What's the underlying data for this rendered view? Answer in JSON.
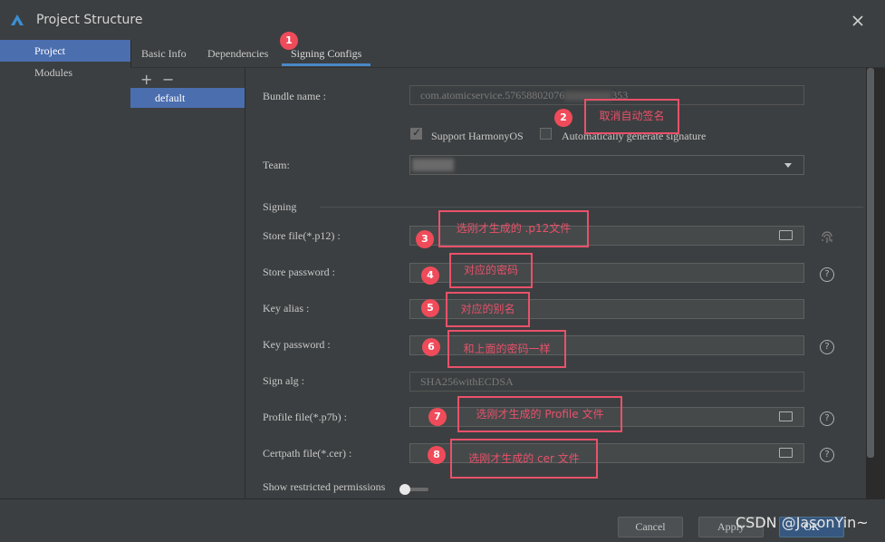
{
  "window": {
    "title": "Project Structure",
    "close_icon": "close-icon"
  },
  "left_nav": {
    "items": [
      {
        "label": "Project",
        "selected": true
      },
      {
        "label": "Modules",
        "selected": false
      }
    ]
  },
  "tabs": [
    {
      "label": "Basic Info"
    },
    {
      "label": "Dependencies"
    },
    {
      "label": "Signing Configs",
      "active": true
    }
  ],
  "config_list": {
    "add_label": "+",
    "remove_label": "−",
    "items": [
      {
        "label": "default"
      }
    ]
  },
  "form": {
    "bundle_name": {
      "label": "Bundle name :",
      "value": "com.atomicservice.57658802076",
      "value_tail": "353"
    },
    "support_harmonyos": {
      "label": "Support HarmonyOS",
      "checked": true
    },
    "auto_sign": {
      "label": "Automatically generate signature",
      "checked": false
    },
    "team": {
      "label": "Team:"
    },
    "signing_section": "Signing",
    "store_file": {
      "label": "Store file(*.p12) :"
    },
    "store_password": {
      "label": "Store password :"
    },
    "key_alias": {
      "label": "Key alias :"
    },
    "key_password": {
      "label": "Key password :"
    },
    "sign_alg": {
      "label": "Sign alg :",
      "value": "SHA256withECDSA"
    },
    "profile_file": {
      "label": "Profile file(*.p7b) :"
    },
    "certpath_file": {
      "label": "Certpath file(*.cer) :"
    },
    "restricted": {
      "label": "Show restricted permissions"
    }
  },
  "footer": {
    "cancel": "Cancel",
    "apply": "Apply",
    "ok": "OK"
  },
  "annotations": [
    {
      "num": "1"
    },
    {
      "num": "2",
      "text": "取消自动签名"
    },
    {
      "num": "3",
      "text": "选刚才生成的 .p12文件"
    },
    {
      "num": "4",
      "text": "对应的密码"
    },
    {
      "num": "5",
      "text": "对应的别名"
    },
    {
      "num": "6",
      "text": "和上面的密码一样"
    },
    {
      "num": "7",
      "text": "选刚才生成的  Profile 文件"
    },
    {
      "num": "8",
      "text": "选刚才生成的  cer 文件"
    }
  ],
  "watermark": "CSDN @JasonYin~",
  "colors": {
    "accent": "#4b6eaf",
    "annotation": "#e9516a",
    "primary_button": "#365880"
  }
}
